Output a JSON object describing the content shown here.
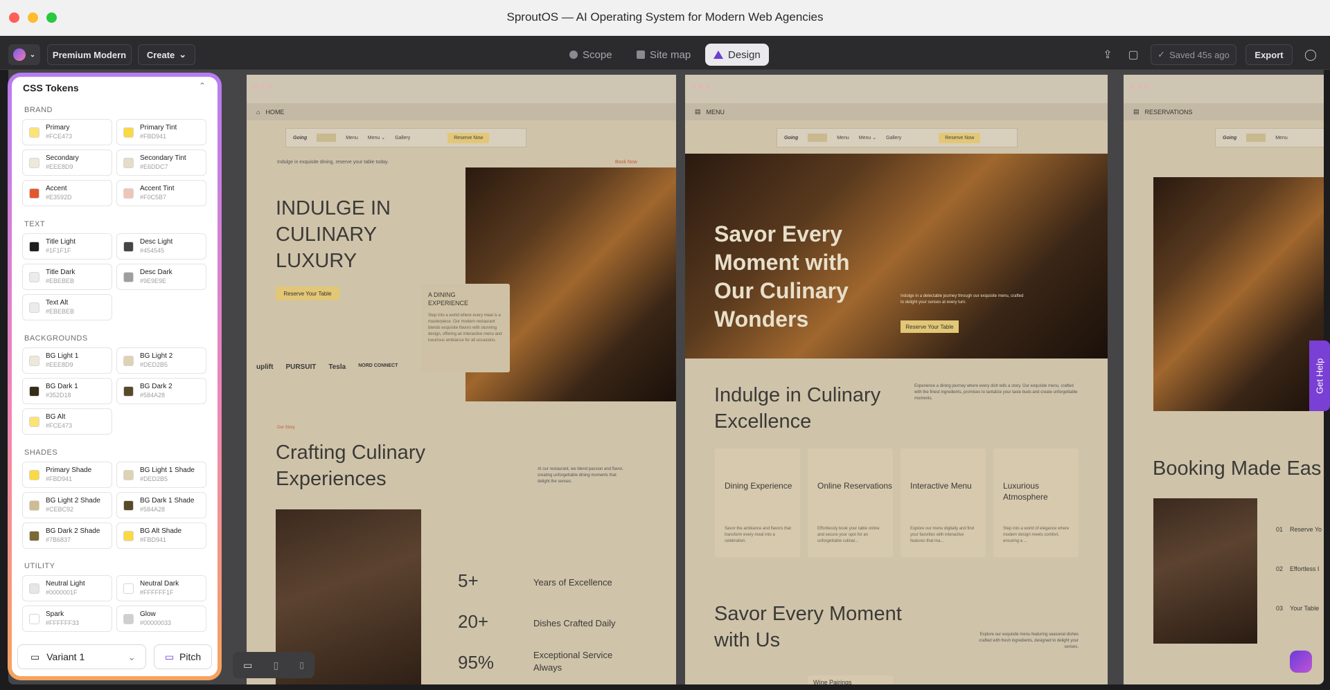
{
  "window": {
    "title": "SproutOS — AI Operating System for Modern Web Agencies"
  },
  "toolbar": {
    "theme": "Premium Modern",
    "create": "Create",
    "tabs": [
      {
        "label": "Scope"
      },
      {
        "label": "Site map"
      },
      {
        "label": "Design"
      }
    ],
    "saved": "Saved 45s ago",
    "export": "Export"
  },
  "tokens_panel": {
    "title": "CSS Tokens",
    "sections": {
      "brand": "BRAND",
      "text": "TEXT",
      "backgrounds": "BACKGROUNDS",
      "shades": "SHADES",
      "utility": "UTILITY"
    },
    "brand": [
      {
        "name": "Primary",
        "hex": "#FCE473",
        "color": "#FCE473"
      },
      {
        "name": "Primary Tint",
        "hex": "#FBD941",
        "color": "#FBD941"
      },
      {
        "name": "Secondary",
        "hex": "#EEE8D9",
        "color": "#EEE8D9"
      },
      {
        "name": "Secondary Tint",
        "hex": "#E6DDC7",
        "color": "#E6DDC7"
      },
      {
        "name": "Accent",
        "hex": "#E3592D",
        "color": "#E3592D"
      },
      {
        "name": "Accent Tint",
        "hex": "#F0C5B7",
        "color": "#F0C5B7"
      }
    ],
    "text": [
      {
        "name": "Title Light",
        "hex": "#1F1F1F",
        "color": "#1F1F1F"
      },
      {
        "name": "Desc Light",
        "hex": "#454545",
        "color": "#454545"
      },
      {
        "name": "Title Dark",
        "hex": "#EBEBEB",
        "color": "#EBEBEB"
      },
      {
        "name": "Desc Dark",
        "hex": "#9E9E9E",
        "color": "#9E9E9E"
      },
      {
        "name": "Text Alt",
        "hex": "#EBEBEB",
        "color": "#EBEBEB"
      }
    ],
    "backgrounds": [
      {
        "name": "BG Light 1",
        "hex": "#EEE8D9",
        "color": "#EEE8D9"
      },
      {
        "name": "BG Light 2",
        "hex": "#DED2B5",
        "color": "#DED2B5"
      },
      {
        "name": "BG Dark 1",
        "hex": "#352D18",
        "color": "#352D18"
      },
      {
        "name": "BG Dark 2",
        "hex": "#584A28",
        "color": "#584A28"
      },
      {
        "name": "BG Alt",
        "hex": "#FCE473",
        "color": "#FCE473"
      }
    ],
    "shades": [
      {
        "name": "Primary Shade",
        "hex": "#FBD941",
        "color": "#FBD941"
      },
      {
        "name": "BG Light 1 Shade",
        "hex": "#DED2B5",
        "color": "#DED2B5"
      },
      {
        "name": "BG Light 2 Shade",
        "hex": "#CEBC92",
        "color": "#CEBC92"
      },
      {
        "name": "BG Dark 1 Shade",
        "hex": "#584A28",
        "color": "#584A28"
      },
      {
        "name": "BG Dark 2 Shade",
        "hex": "#7B6837",
        "color": "#7B6837"
      },
      {
        "name": "BG Alt Shade",
        "hex": "#FBD941",
        "color": "#FBD941"
      }
    ],
    "utility": [
      {
        "name": "Neutral Light",
        "hex": "#0000001F",
        "color": "#e6e6e6"
      },
      {
        "name": "Neutral Dark",
        "hex": "#FFFFFF1F",
        "color": "#ffffff"
      },
      {
        "name": "Spark",
        "hex": "#FFFFFF33",
        "color": "#ffffff"
      },
      {
        "name": "Glow",
        "hex": "#00000033",
        "color": "#cfcfcf"
      }
    ],
    "variant": "Variant 1",
    "pitch": "Pitch"
  },
  "frames": {
    "home": {
      "tab": "HOME",
      "nav": {
        "logo": "Going",
        "menu": "Menu",
        "menu2": "Menu ⌄",
        "gallery": "Gallery",
        "cta": "Reserve Now"
      },
      "announce": "Indulge in exquisite dining, reserve your table today.",
      "announce_link": "Book Now",
      "hero_title_1": "INDULGE IN",
      "hero_title_2": "CULINARY",
      "hero_title_3": "LUXURY",
      "hero_cta": "Reserve Your Table",
      "card_title": "A DINING EXPERIENCE",
      "card_text": "Step into a world where every meal is a masterpiece. Our modern restaurant blends exquisite flavors with stunning design, offering an interactive menu and luxurious ambiance for all occasions.",
      "logos": [
        "uplift",
        "PURSUIT",
        "Tesla",
        "NORD CONNECT"
      ],
      "story_tag": "Our Story",
      "section_title_1": "Crafting Culinary",
      "section_title_2": "Experiences",
      "section_text": "At our restaurant, we blend passion and flavor, creating unforgettable dining moments that delight the senses.",
      "stats": [
        {
          "value": "5+",
          "label": "Years of Excellence"
        },
        {
          "value": "20+",
          "label": "Dishes Crafted Daily"
        },
        {
          "value": "95%",
          "label": "Exceptional Service Always"
        }
      ]
    },
    "menu": {
      "tab": "MENU",
      "hero_title": "Savor Every Moment with Our Culinary Wonders",
      "hero_text": "Indulge in a delectable journey through our exquisite menu, crafted to delight your senses at every turn.",
      "hero_cta": "Reserve Your Table",
      "section_title_1": "Indulge in Culinary",
      "section_title_2": "Excellence",
      "section_text": "Experience a dining journey where every dish tells a story. Our exquisite menu, crafted with the finest ingredients, promises to tantalize your taste buds and create unforgettable moments.",
      "cards": [
        {
          "title": "Dining Experience",
          "text": "Savor the ambiance and flavors that transform every meal into a celebration."
        },
        {
          "title": "Online Reservations",
          "text": "Effortlessly book your table online and secure your spot for an unforgettable culinar..."
        },
        {
          "title": "Interactive Menu",
          "text": "Explore our menu digitally and find your favorites with interactive features that ma..."
        },
        {
          "title": "Luxurious Atmosphere",
          "text": "Step into a world of elegance where modern design meets comfort, ensuring a ..."
        }
      ],
      "bottom_title_1": "Savor Every Moment",
      "bottom_title_2": "with Us",
      "bottom_text": "Explore our exquisite menu featuring seasonal dishes crafted with fresh ingredients, designed to delight your senses.",
      "bottom_card": "Wine Pairings"
    },
    "reservations": {
      "tab": "RESERVATIONS",
      "title": "Booking Made Eas",
      "steps": [
        {
          "num": "01",
          "label": "Reserve Yo"
        },
        {
          "num": "02",
          "label": "Effortless I"
        },
        {
          "num": "03",
          "label": "Your Table"
        }
      ]
    }
  },
  "help": "Get Help"
}
